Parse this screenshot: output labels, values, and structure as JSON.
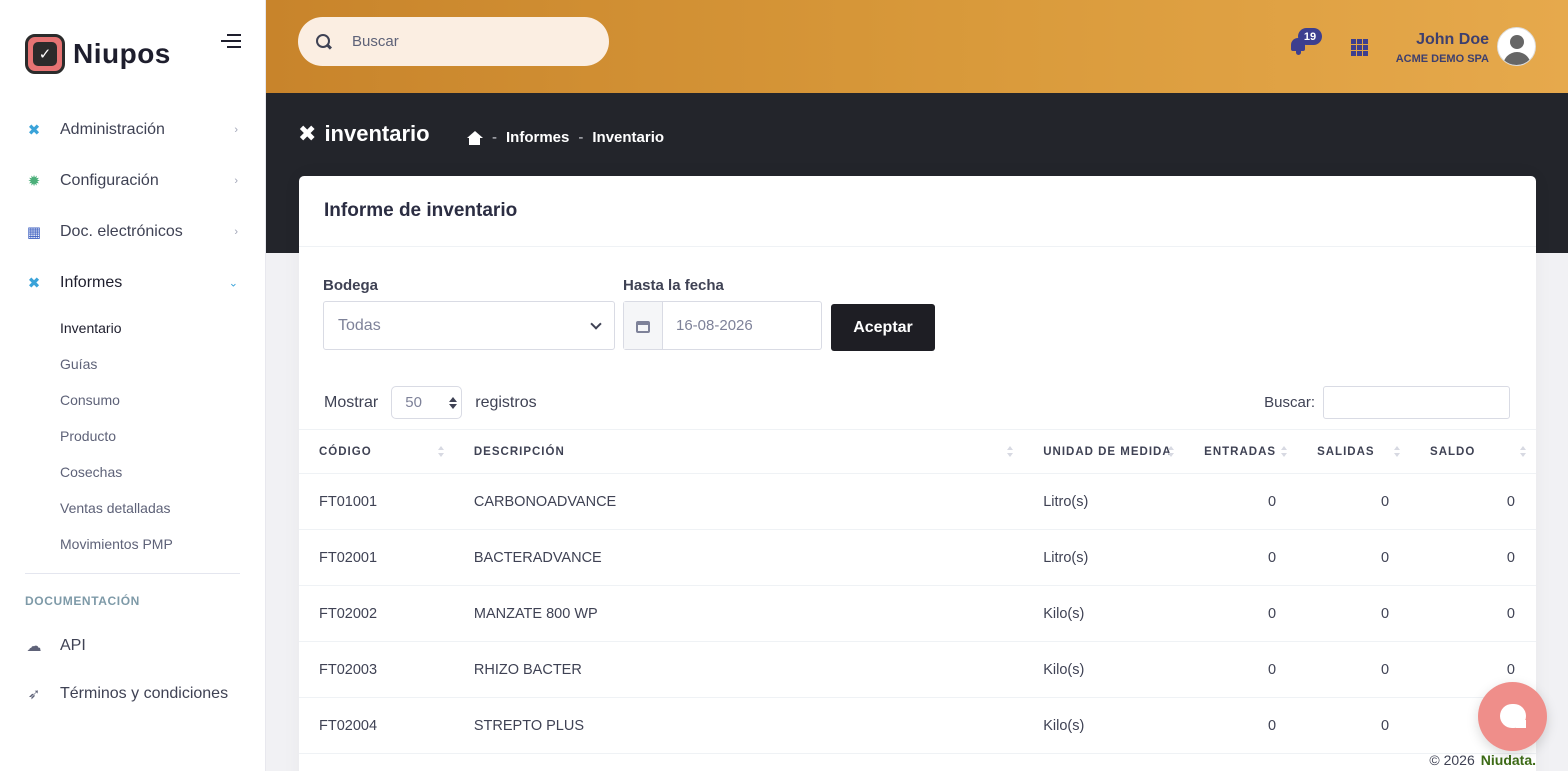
{
  "brand": {
    "name": "Niupos",
    "logo_icon": "check-square-icon"
  },
  "sidebar": {
    "items": [
      {
        "label": "Administración",
        "icon": "tools-icon"
      },
      {
        "label": "Configuración",
        "icon": "gear-icon"
      },
      {
        "label": "Doc. electrónicos",
        "icon": "cash-register-icon"
      },
      {
        "label": "Informes",
        "icon": "tools-icon",
        "expanded": true
      }
    ],
    "informes_submenu": [
      "Inventario",
      "Guías",
      "Consumo",
      "Producto",
      "Cosechas",
      "Ventas detalladas",
      "Movimientos PMP"
    ],
    "section_title": "DOCUMENTACIÓN",
    "doc_items": [
      {
        "label": "API",
        "icon": "cloud-icon"
      },
      {
        "label": "Términos y condiciones",
        "icon": "rocket-icon"
      }
    ]
  },
  "header": {
    "search_placeholder": "Buscar",
    "notifications_count": "19",
    "user_name": "John Doe",
    "user_company": "ACME DEMO SPA"
  },
  "toolbar": {
    "title": "inventario",
    "breadcrumb": [
      "Informes",
      "Inventario"
    ]
  },
  "card": {
    "title": "Informe de inventario",
    "bodega_label": "Bodega",
    "bodega_value": "Todas",
    "fecha_label": "Hasta la fecha",
    "fecha_value": "16-08-2026",
    "accept_label": "Aceptar",
    "show_label": "Mostrar",
    "page_length": "50",
    "records_label": "registros",
    "filter_label": "Buscar:"
  },
  "table": {
    "columns": [
      "CÓDIGO",
      "DESCRIPCIÓN",
      "UNIDAD DE MEDIDA",
      "ENTRADAS",
      "SALIDAS",
      "SALDO"
    ],
    "rows": [
      [
        "FT01001",
        "CARBONOADVANCE",
        "Litro(s)",
        "0",
        "0",
        "0"
      ],
      [
        "FT02001",
        "BACTERADVANCE",
        "Litro(s)",
        "0",
        "0",
        "0"
      ],
      [
        "FT02002",
        "MANZATE 800 WP",
        "Kilo(s)",
        "0",
        "0",
        "0"
      ],
      [
        "FT02003",
        "RHIZO BACTER",
        "Kilo(s)",
        "0",
        "0",
        "0"
      ],
      [
        "FT02004",
        "STREPTO PLUS",
        "Kilo(s)",
        "0",
        "0",
        "0"
      ]
    ]
  },
  "footer": {
    "copyright": "© 2026",
    "brand": "Niudata."
  },
  "colors": {
    "accent": "#3aa3d9",
    "topbar": "#d99a3b",
    "dark": "#23252b",
    "chat": "#ef8e8a"
  }
}
